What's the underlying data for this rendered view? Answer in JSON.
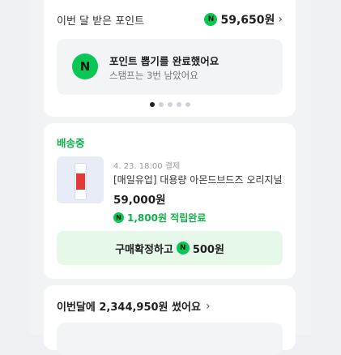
{
  "points": {
    "label": "이번 달 받은 포인트",
    "amount": "59,650원",
    "chevron": "›"
  },
  "stamp": {
    "badge": "N",
    "title": "포인트 뽑기를 완료했어요",
    "subtitle": "스탬프는 3번 남았어요"
  },
  "carousel": {
    "total": 5,
    "active_index": 0
  },
  "delivery": {
    "status": "배송중",
    "order_date": "4. 23. 18:00 결제",
    "product_name": "[매일유업] 대용량 아몬드브드즈 오리지널..",
    "price": "59,000원",
    "reward": "1,800원 적립완료",
    "confirm_prefix": "구매확정하고",
    "confirm_amount": "500원"
  },
  "spending": {
    "summary": "이번달에 2,344,950원 썼어요",
    "chevron": "›"
  },
  "colors": {
    "accent_green": "#12b14b",
    "badge_green": "#0ac655",
    "button_bg": "#e5f8ea"
  },
  "icons": {
    "points_badge": "naver-pay-n-icon",
    "product_thumb": "product-image"
  }
}
